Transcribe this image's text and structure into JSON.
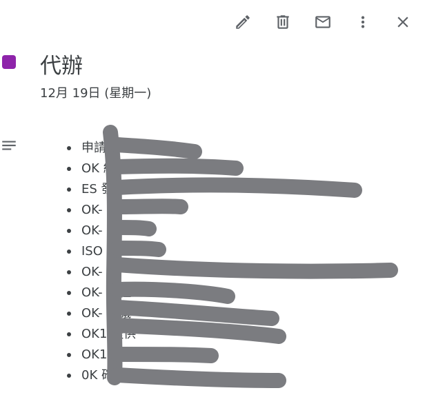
{
  "toolbar": {
    "edit_icon": "pencil-icon",
    "delete_icon": "trash-icon",
    "email_icon": "mail-icon",
    "options_icon": "more-vert-icon",
    "close_icon": "close-icon"
  },
  "event": {
    "title": "代辦",
    "date": "12月 19日 (星期一)",
    "calendar_color": "#8e24aa"
  },
  "description": {
    "icon": "notes-icon",
    "items": [
      {
        "visible_text": "申請          費用"
      },
      {
        "visible_text": "OK                          紗"
      },
      {
        "visible_text": " ES                                                      發OK"
      },
      {
        "visible_text": "OK-"
      },
      {
        "visible_text": "OK-"
      },
      {
        "visible_text": "ISO                  得"
      },
      {
        "visible_text": "OK-                                                            消"
      },
      {
        "visible_text": "OK-                          課程"
      },
      {
        "visible_text": "OK-                           會議"
      },
      {
        "visible_text": "OK1                     提供"
      },
      {
        "visible_text": "OK1                          訊"
      },
      {
        "visible_text": "0K                           確認"
      }
    ]
  },
  "redaction_color": "#7b7c80"
}
